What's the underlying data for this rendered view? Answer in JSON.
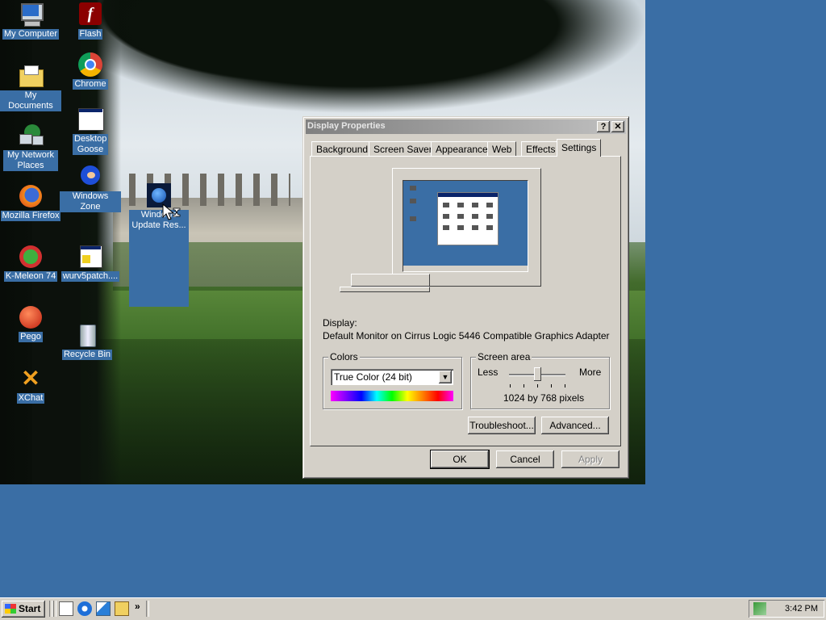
{
  "desktop": {
    "icons": [
      {
        "label": "My Computer",
        "icon": "computer-icon"
      },
      {
        "label": "Flash",
        "icon": "flash-icon"
      },
      {
        "label": "Chrome",
        "icon": "chrome-icon"
      },
      {
        "label": "My Documents",
        "icon": "folder-icon"
      },
      {
        "label": "Desktop Goose",
        "icon": "window-icon"
      },
      {
        "label": "My Network Places",
        "icon": "network-icon"
      },
      {
        "label": "Windows Zone",
        "icon": "sonic-icon"
      },
      {
        "label": "Windows Update Res...",
        "icon": "globe-icon"
      },
      {
        "label": "Mozilla Firefox",
        "icon": "firefox-icon"
      },
      {
        "label": "K-Meleon 74",
        "icon": "kmeleon-icon"
      },
      {
        "label": "wurv5patch....",
        "icon": "installer-icon"
      },
      {
        "label": "Pego",
        "icon": "pego-icon"
      },
      {
        "label": "Recycle Bin",
        "icon": "recycle-bin-icon"
      },
      {
        "label": "XChat",
        "icon": "xchat-icon"
      }
    ]
  },
  "dialog": {
    "title": "Display Properties",
    "help_label": "?",
    "close_label": "✕",
    "tabs": [
      "Background",
      "Screen Saver",
      "Appearance",
      "Web",
      "Effects",
      "Settings"
    ],
    "active_tab": "Settings",
    "display_label": "Display:",
    "display_value": "Default Monitor on Cirrus Logic 5446 Compatible Graphics Adapter",
    "colors_group": "Colors",
    "colors_value": "True Color (24 bit)",
    "screen_area_group": "Screen area",
    "less_label": "Less",
    "more_label": "More",
    "resolution": "1024 by 768 pixels",
    "slider_position": 0.5,
    "troubleshoot_label": "Troubleshoot...",
    "advanced_label": "Advanced...",
    "ok_label": "OK",
    "cancel_label": "Cancel",
    "apply_label": "Apply"
  },
  "taskbar": {
    "start_label": "Start",
    "chevron": "»",
    "clock": "3:42 PM"
  },
  "colors": {
    "desktop": "#3a6ea5",
    "face": "#d4d0c8",
    "inactive_title": "#808080"
  }
}
